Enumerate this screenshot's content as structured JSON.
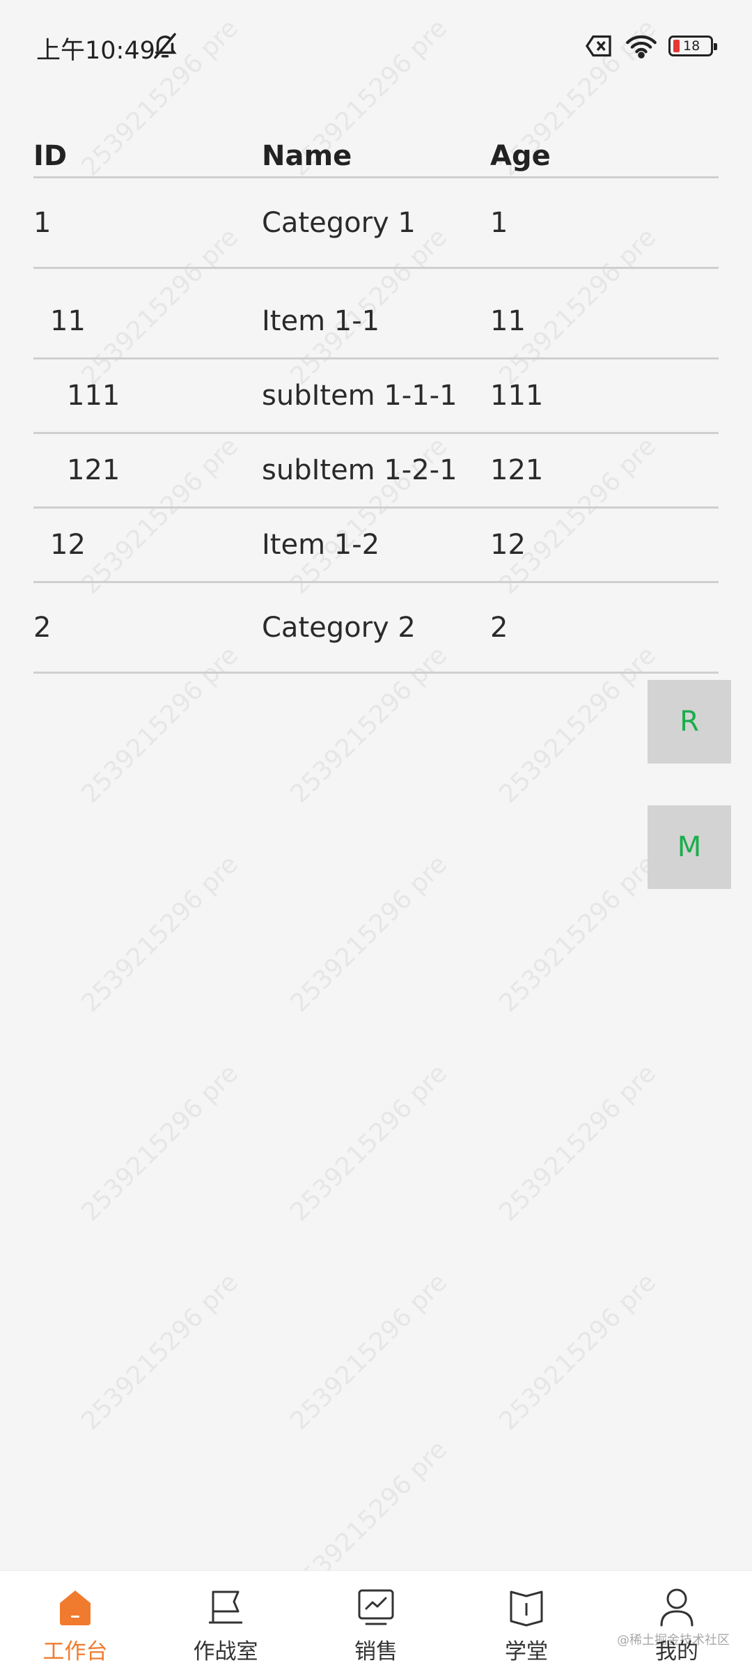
{
  "status_bar": {
    "time": "上午10:49",
    "battery_level": "18"
  },
  "table": {
    "headers": [
      "ID",
      "Name",
      "Age"
    ],
    "rows": [
      {
        "id": "1",
        "name": "Category 1",
        "age": "1"
      },
      {
        "id": "11",
        "name": "Item 1-1",
        "age": "11"
      },
      {
        "id": "111",
        "name": "subItem 1-1-1",
        "age": "111"
      },
      {
        "id": "121",
        "name": "subItem 1-2-1",
        "age": "121"
      },
      {
        "id": "12",
        "name": "Item 1-2",
        "age": "12"
      },
      {
        "id": "2",
        "name": "Category 2",
        "age": "2"
      }
    ]
  },
  "floating_buttons": {
    "r_label": "R",
    "m_label": "M"
  },
  "watermark": "2539215296 pre",
  "bottom_nav": {
    "items": [
      {
        "label": "工作台",
        "icon": "home-icon",
        "active": true
      },
      {
        "label": "作战室",
        "icon": "flag-icon",
        "active": false
      },
      {
        "label": "销售",
        "icon": "chart-monitor-icon",
        "active": false
      },
      {
        "label": "学堂",
        "icon": "book-icon",
        "active": false
      },
      {
        "label": "我的",
        "icon": "user-icon",
        "active": false
      }
    ]
  },
  "corner_mark": "@稀土掘金技术社区",
  "colors": {
    "accent": "#f07b2e",
    "fab_text": "#1aad4b",
    "fab_bg": "#d3d3d3",
    "background": "#f5f5f5"
  }
}
